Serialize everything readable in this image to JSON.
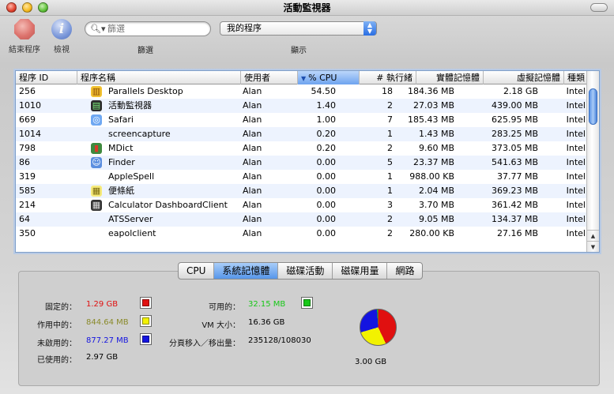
{
  "window": {
    "title": "活動監視器"
  },
  "toolbar": {
    "quit_label": "結束程序",
    "inspect_label": "檢視",
    "search_placeholder": "篩選",
    "filter_label": "篩選",
    "show_label": "顯示",
    "show_value": "我的程序"
  },
  "table": {
    "columns": [
      "程序 ID",
      "程序名稱",
      "使用者",
      "% CPU",
      "# 執行緒",
      "實體記憶體",
      "虛擬記憶體",
      "種類"
    ],
    "sorted_column": "% CPU",
    "rows": [
      {
        "pid": "256",
        "name": "Parallels Desktop",
        "icon": "parallels-icon",
        "user": "Alan",
        "cpu": "54.50",
        "threads": "18",
        "real": "184.36 MB",
        "virtual": "2.18 GB",
        "kind": "Intel"
      },
      {
        "pid": "1010",
        "name": "活動監視器",
        "icon": "activity-monitor-icon",
        "user": "Alan",
        "cpu": "1.40",
        "threads": "2",
        "real": "27.03 MB",
        "virtual": "439.00 MB",
        "kind": "Intel"
      },
      {
        "pid": "669",
        "name": "Safari",
        "icon": "safari-icon",
        "user": "Alan",
        "cpu": "1.00",
        "threads": "7",
        "real": "185.43 MB",
        "virtual": "625.95 MB",
        "kind": "Intel"
      },
      {
        "pid": "1014",
        "name": "screencapture",
        "icon": "",
        "user": "Alan",
        "cpu": "0.20",
        "threads": "1",
        "real": "1.43 MB",
        "virtual": "283.25 MB",
        "kind": "Intel"
      },
      {
        "pid": "798",
        "name": "MDict",
        "icon": "mdict-icon",
        "user": "Alan",
        "cpu": "0.20",
        "threads": "2",
        "real": "9.60 MB",
        "virtual": "373.05 MB",
        "kind": "Intel"
      },
      {
        "pid": "86",
        "name": "Finder",
        "icon": "finder-icon",
        "user": "Alan",
        "cpu": "0.00",
        "threads": "5",
        "real": "23.37 MB",
        "virtual": "541.63 MB",
        "kind": "Intel"
      },
      {
        "pid": "319",
        "name": "AppleSpell",
        "icon": "",
        "user": "Alan",
        "cpu": "0.00",
        "threads": "1",
        "real": "988.00 KB",
        "virtual": "37.77 MB",
        "kind": "Intel"
      },
      {
        "pid": "585",
        "name": "便條紙",
        "icon": "stickies-icon",
        "user": "Alan",
        "cpu": "0.00",
        "threads": "1",
        "real": "2.04 MB",
        "virtual": "369.23 MB",
        "kind": "Intel"
      },
      {
        "pid": "214",
        "name": "Calculator DashboardClient",
        "icon": "calculator-icon",
        "user": "Alan",
        "cpu": "0.00",
        "threads": "3",
        "real": "3.70 MB",
        "virtual": "361.42 MB",
        "kind": "Intel"
      },
      {
        "pid": "64",
        "name": "ATSServer",
        "icon": "",
        "user": "Alan",
        "cpu": "0.00",
        "threads": "2",
        "real": "9.05 MB",
        "virtual": "134.37 MB",
        "kind": "Intel"
      },
      {
        "pid": "350",
        "name": "eapolclient",
        "icon": "",
        "user": "Alan",
        "cpu": "0.00",
        "threads": "2",
        "real": "280.00 KB",
        "virtual": "27.16 MB",
        "kind": "Intel"
      }
    ]
  },
  "tabs": [
    "CPU",
    "系統記憶體",
    "磁碟活動",
    "磁碟用量",
    "網路"
  ],
  "active_tab": "系統記憶體",
  "memory": {
    "wired_label": "固定的：",
    "wired_value": "1.29 GB",
    "wired_color": "#e01010",
    "active_label": "作用中的：",
    "active_value": "844.64 MB",
    "active_color": "#f2f200",
    "inactive_label": "未啟用的：",
    "inactive_value": "877.27 MB",
    "inactive_color": "#1414e0",
    "used_label": "已使用的：",
    "used_value": "2.97 GB",
    "free_label": "可用的：",
    "free_value": "32.15 MB",
    "free_color": "#18c818",
    "vm_label": "VM 大小：",
    "vm_value": "16.36 GB",
    "pages_label": "分頁移入／移出量：",
    "pages_value": "235128/108030",
    "total_value": "3.00 GB"
  }
}
